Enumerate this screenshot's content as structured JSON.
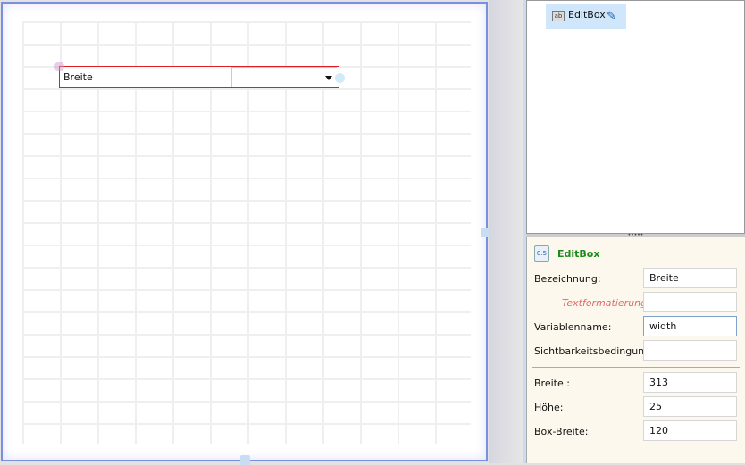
{
  "canvas": {
    "widget": {
      "label": "Breite",
      "dropdown_value": ""
    }
  },
  "tree": {
    "item_label": "EditBox",
    "item_icon": "ab"
  },
  "props": {
    "title": "EditBox",
    "title_icon": "0.5",
    "fields": [
      {
        "label": "Bezeichnung:",
        "value": "Breite"
      },
      {
        "label": "Textformatierung:",
        "value": ""
      },
      {
        "label": "Variablenname:",
        "value": "width"
      },
      {
        "label": "Sichtbarkeitsbedingung:",
        "value": ""
      }
    ],
    "size_fields": [
      {
        "label": "Breite :",
        "value": "313"
      },
      {
        "label": "Höhe:",
        "value": "25"
      },
      {
        "label": "Box-Breite:",
        "value": "120"
      }
    ]
  },
  "colors": {
    "accent": "#7b8fe0",
    "selection": "#cfe6fb",
    "title_green": "#1a8a1a",
    "warning_label": "#e06a6a"
  }
}
